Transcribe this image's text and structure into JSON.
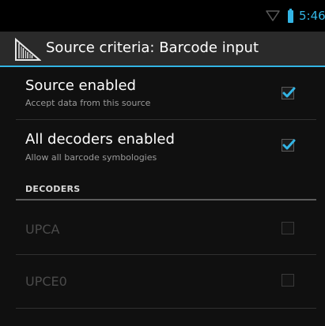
{
  "status_bar": {
    "time": "5:46",
    "wifi_icon": "wifi-icon",
    "battery_icon": "battery-icon",
    "accent_color": "#33b5e5"
  },
  "action_bar": {
    "icon": "barcode-icon",
    "title": "Source criteria: Barcode input"
  },
  "preferences": [
    {
      "title": "Source enabled",
      "summary": "Accept data from this source",
      "checked": true
    },
    {
      "title": "All decoders enabled",
      "summary": "Allow all barcode symbologies",
      "checked": true
    }
  ],
  "category": {
    "title": "DECODERS"
  },
  "decoders": [
    {
      "title": "UPCA",
      "checked": false,
      "enabled": false
    },
    {
      "title": "UPCE0",
      "checked": false,
      "enabled": false
    }
  ]
}
